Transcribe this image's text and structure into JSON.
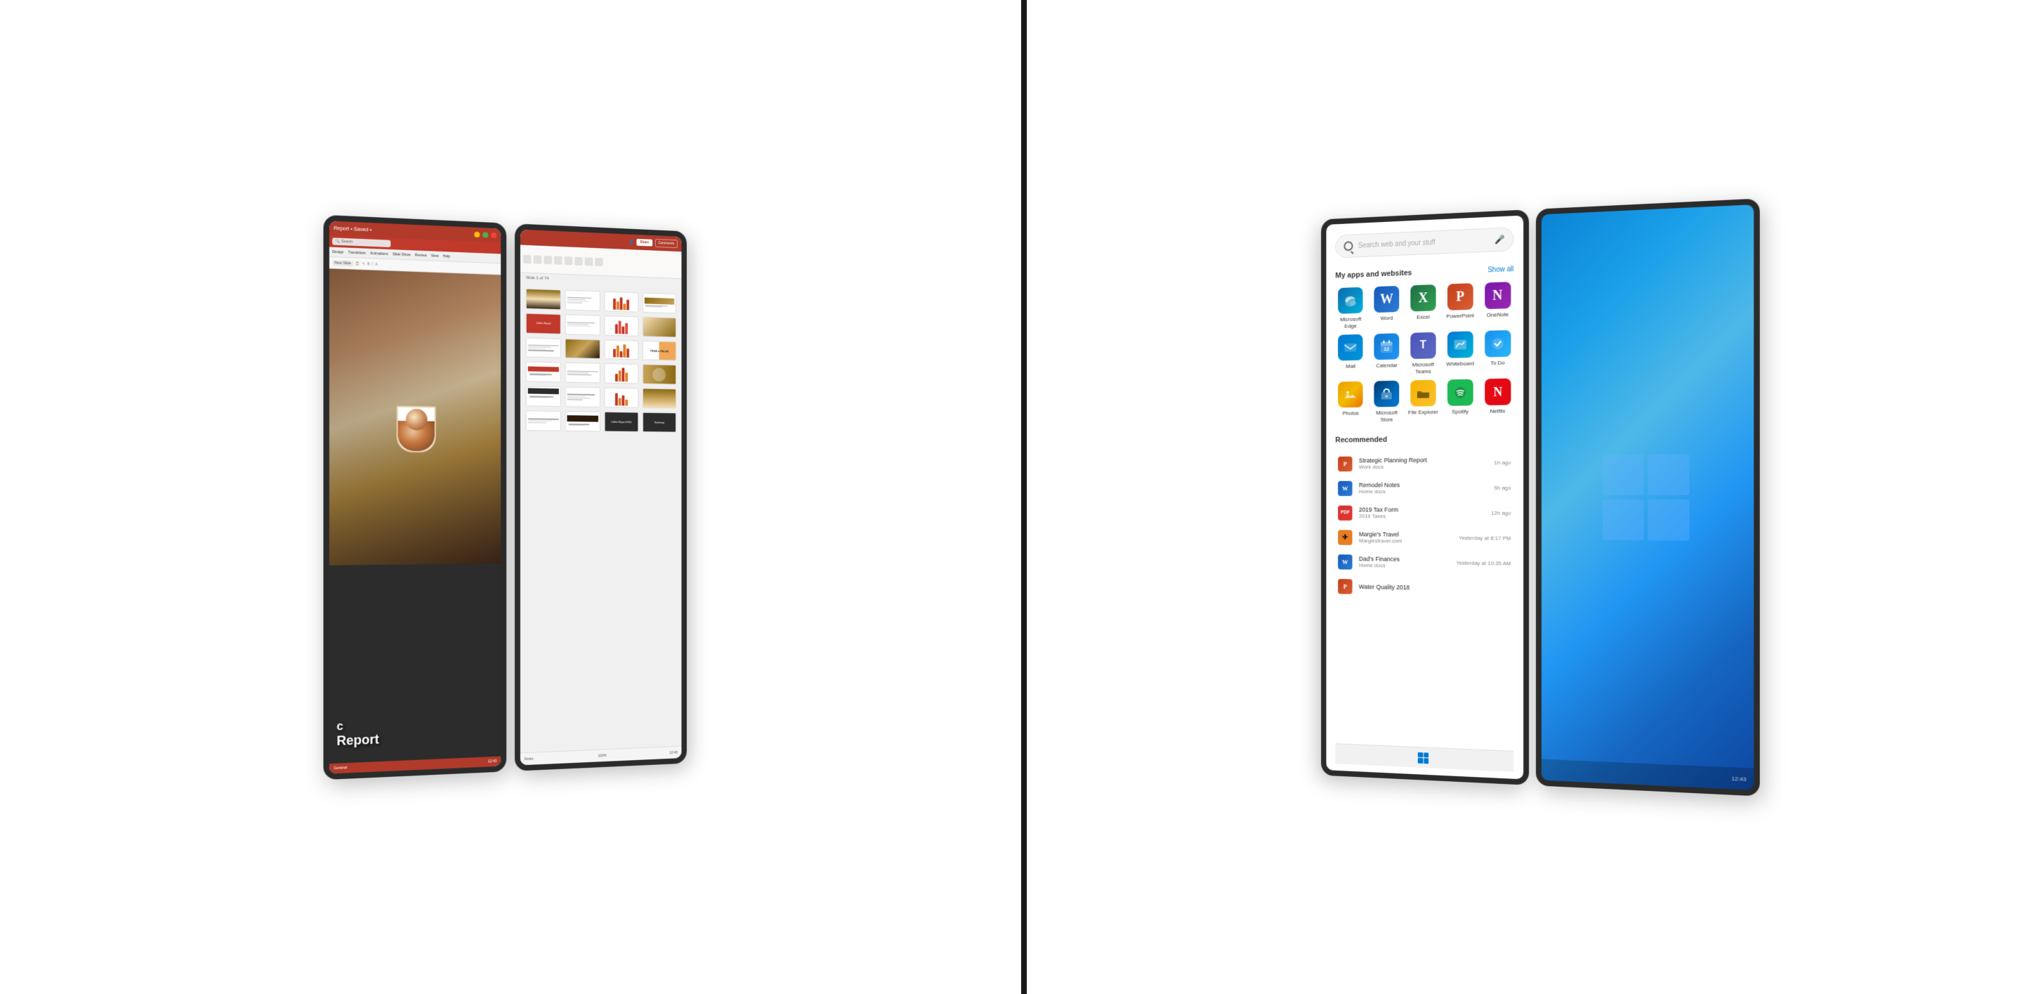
{
  "left_device": {
    "left_screen": {
      "titlebar": {
        "doc_name": "Report • Saved •",
        "search_placeholder": "Search"
      },
      "ribbon_tabs": [
        "Design",
        "Transitions",
        "Animations",
        "Slide Show",
        "Review",
        "View",
        "Help"
      ],
      "toolbar_items": [
        "New Slide"
      ],
      "slide": {
        "title_letter": "c",
        "title_report": "Report"
      },
      "status": "General"
    },
    "right_screen": {
      "toolbar": {
        "share_label": "Share",
        "comments_label": "Comments"
      },
      "slides_count": 24,
      "bottom_bar": {
        "notes": "Notes",
        "zoom": "100%"
      }
    }
  },
  "right_device": {
    "left_screen": {
      "search": {
        "placeholder": "Search web and your stuff"
      },
      "apps_section": {
        "title": "My apps and websites",
        "show_all": "Show all",
        "apps": [
          {
            "name": "Microsoft Edge",
            "icon": "edge",
            "label": "Microsoft Edge"
          },
          {
            "name": "Word",
            "icon": "word",
            "label": "Word"
          },
          {
            "name": "Excel",
            "icon": "excel",
            "label": "Excel"
          },
          {
            "name": "PowerPoint",
            "icon": "powerpoint",
            "label": "PowerPoint"
          },
          {
            "name": "OneNote",
            "icon": "onenote",
            "label": "OneNote"
          },
          {
            "name": "Mail",
            "icon": "mail",
            "label": "Mail"
          },
          {
            "name": "Calendar",
            "icon": "calendar",
            "label": "Calendar"
          },
          {
            "name": "Microsoft Teams",
            "icon": "teams",
            "label": "Microsoft Teams"
          },
          {
            "name": "Whiteboard",
            "icon": "whiteboard",
            "label": "Whiteboard"
          },
          {
            "name": "To Do",
            "icon": "todo",
            "label": "To Do"
          },
          {
            "name": "Photos",
            "icon": "photos",
            "label": "Photos"
          },
          {
            "name": "Microsoft Store",
            "icon": "store",
            "label": "Microsoft Store"
          },
          {
            "name": "File Explorer",
            "icon": "explorer",
            "label": "File Explorer"
          },
          {
            "name": "Spotify",
            "icon": "spotify",
            "label": "Spotify"
          },
          {
            "name": "Netflix",
            "icon": "netflix",
            "label": "Netflix"
          }
        ]
      },
      "recommended_section": {
        "title": "Recommended",
        "items": [
          {
            "title": "Strategic Planning Report",
            "subtitle": "Work docs",
            "time": "1h ago",
            "icon": "ppt"
          },
          {
            "title": "Remodel Notes",
            "subtitle": "Home docs",
            "time": "5h ago",
            "icon": "word"
          },
          {
            "title": "2019 Tax Form",
            "subtitle": "2019 Taxes",
            "time": "12h ago",
            "icon": "pdf"
          },
          {
            "title": "Margie's Travel",
            "subtitle": "Margiestravel.com",
            "time": "Yesterday at 8:17 PM",
            "icon": "orange"
          },
          {
            "title": "Dad's Finances",
            "subtitle": "Home docs",
            "time": "Yesterday at 10:35 AM",
            "icon": "word"
          },
          {
            "title": "Water Quality 2018",
            "subtitle": "",
            "time": "",
            "icon": "ppt"
          }
        ]
      }
    },
    "right_screen": {
      "type": "desktop"
    }
  }
}
